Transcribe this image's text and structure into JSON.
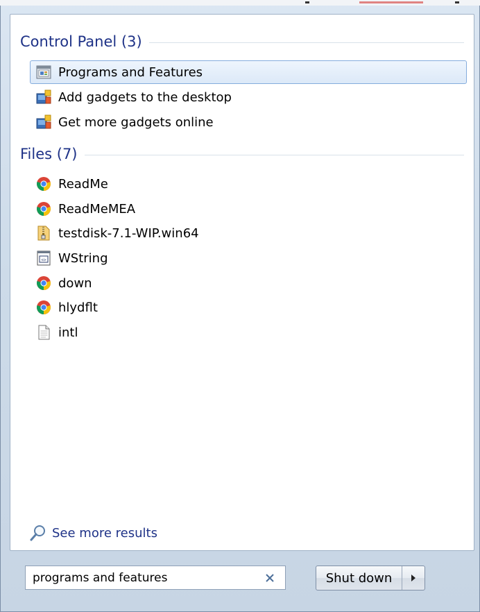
{
  "control_panel": {
    "title": "Control Panel (3)",
    "items": [
      {
        "label": "Programs and Features",
        "icon": "programs-features-icon",
        "selected": true
      },
      {
        "label": "Add gadgets to the desktop",
        "icon": "gadgets-icon",
        "selected": false
      },
      {
        "label": "Get more gadgets online",
        "icon": "gadgets-icon",
        "selected": false
      }
    ]
  },
  "files": {
    "title": "Files (7)",
    "items": [
      {
        "label": "ReadMe",
        "icon": "chrome-icon"
      },
      {
        "label": "ReadMeMEA",
        "icon": "chrome-icon"
      },
      {
        "label": "testdisk-7.1-WIP.win64",
        "icon": "zip-folder-icon"
      },
      {
        "label": "WString",
        "icon": "source-file-icon"
      },
      {
        "label": "down",
        "icon": "chrome-icon"
      },
      {
        "label": "hlydflt",
        "icon": "chrome-icon"
      },
      {
        "label": "intl",
        "icon": "text-file-icon"
      }
    ]
  },
  "see_more": {
    "label": "See more results",
    "icon": "search-icon"
  },
  "search": {
    "value": "programs and features"
  },
  "shutdown": {
    "label": "Shut down",
    "arrow_icon": "arrow-right-icon"
  },
  "colors": {
    "group_header": "#1e3287",
    "selection_border": "#84acdd",
    "link": "#1e3287"
  }
}
